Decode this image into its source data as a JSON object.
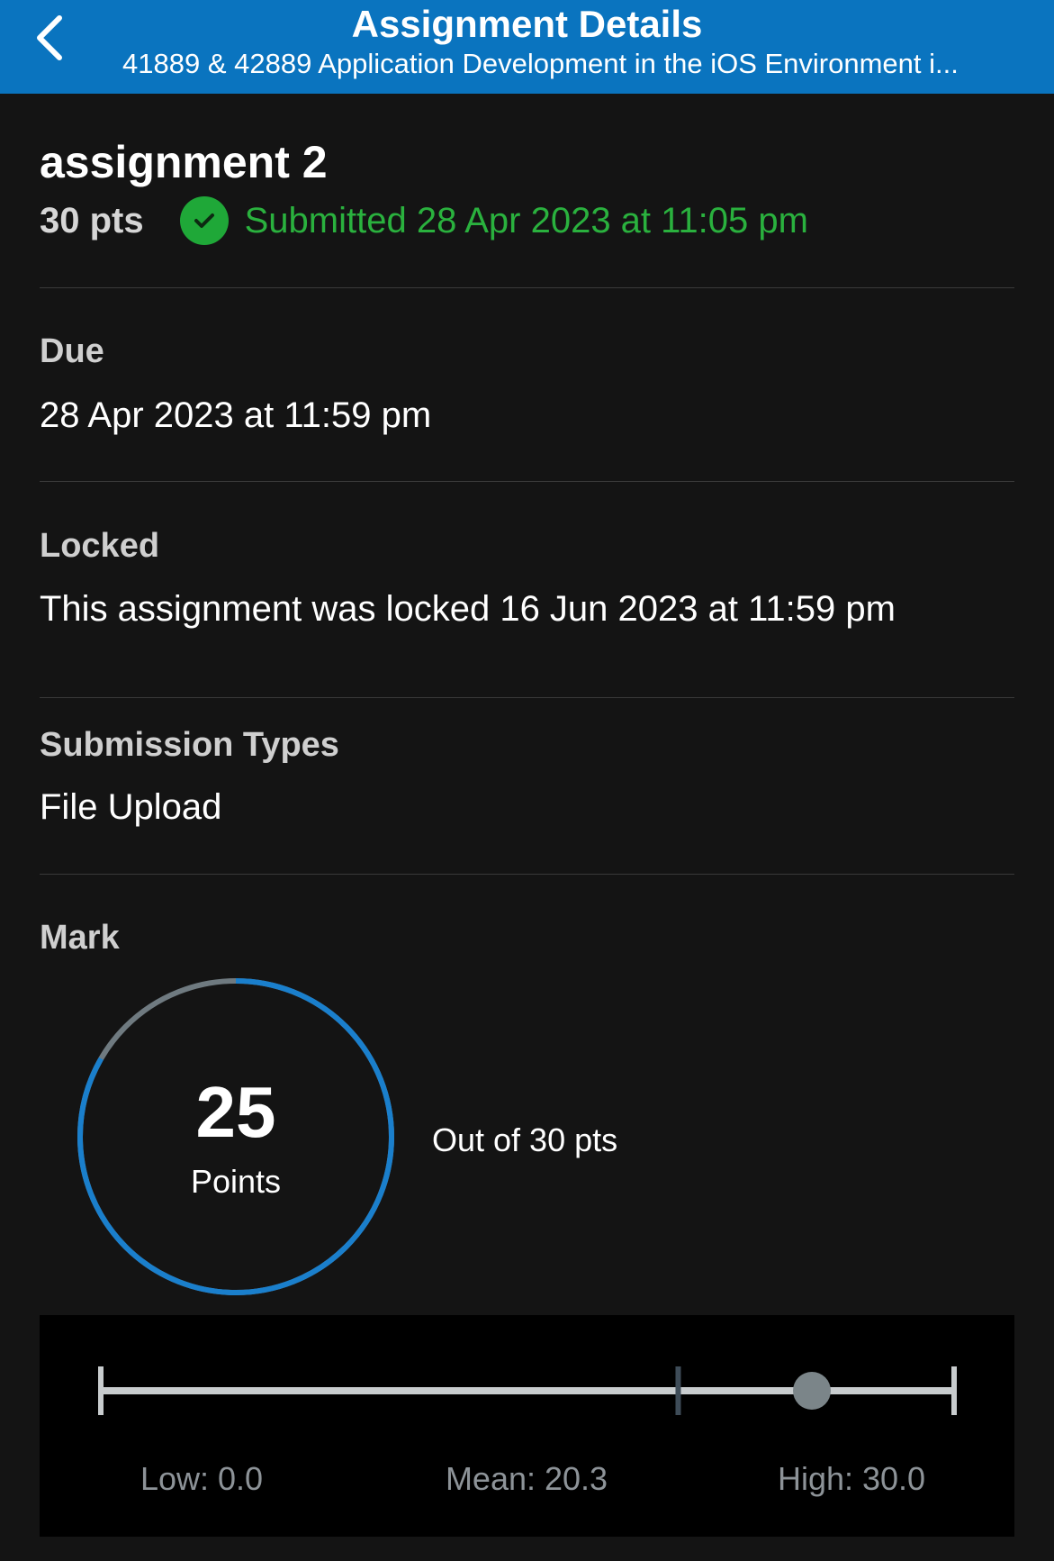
{
  "header": {
    "title": "Assignment Details",
    "subtitle": "41889 & 42889 Application Development in the iOS Environment i..."
  },
  "assignment": {
    "name": "assignment 2",
    "points": "30 pts",
    "status": "Submitted 28 Apr 2023 at 11:05 pm"
  },
  "due": {
    "label": "Due",
    "value": "28 Apr 2023 at 11:59 pm"
  },
  "locked": {
    "label": "Locked",
    "value": "This assignment was locked 16 Jun 2023 at 11:59 pm"
  },
  "submission_types": {
    "label": "Submission Types",
    "value": "File Upload"
  },
  "mark": {
    "label": "Mark",
    "score": "25",
    "score_unit": "Points",
    "out_of": "Out of 30 pts",
    "score_value": 25,
    "max_value": 30
  },
  "stats": {
    "low_label": "Low: 0.0",
    "mean_label": "Mean: 20.3",
    "high_label": "High: 30.0",
    "low": 0.0,
    "mean": 20.3,
    "high": 30.0
  },
  "colors": {
    "header_bg": "#0a74bf",
    "accent": "#1a7fcc",
    "success": "#2ab13e",
    "background": "#141414"
  },
  "icons": {
    "back": "chevron-left-icon",
    "status": "check-circle-icon"
  }
}
